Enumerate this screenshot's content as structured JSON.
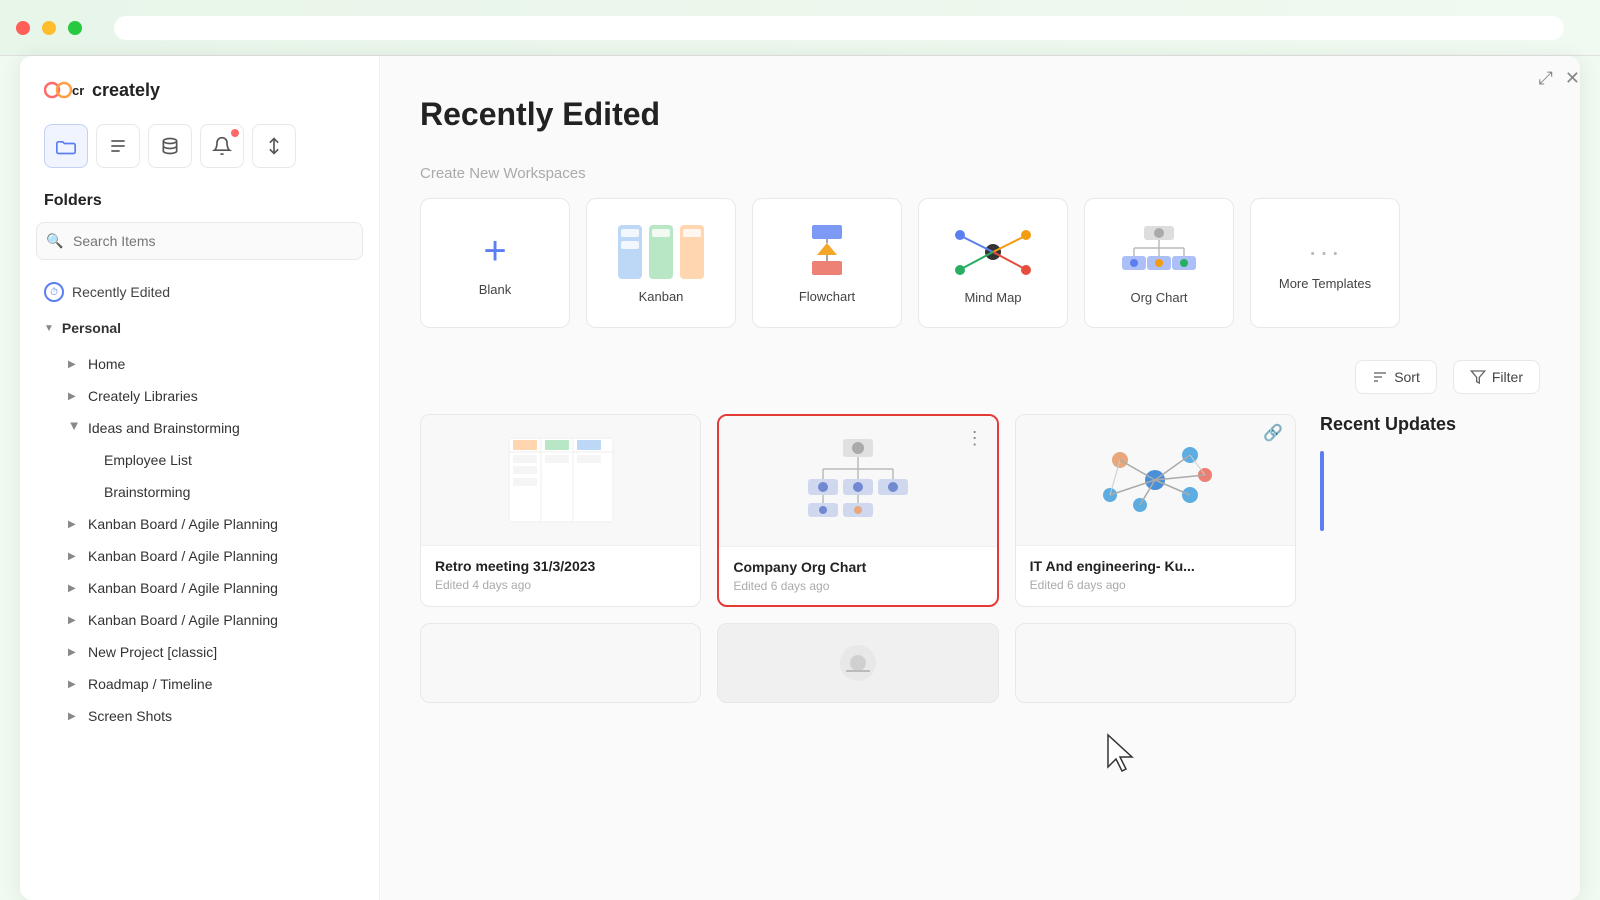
{
  "titlebar": {
    "dots": [
      "red",
      "yellow",
      "green"
    ]
  },
  "sidebar": {
    "logo_text": "creately",
    "folders_label": "Folders",
    "search_placeholder": "Search Items",
    "recently_edited_label": "Recently Edited",
    "personal_label": "Personal",
    "items": [
      {
        "label": "Home",
        "indent": 1,
        "arrow": "right"
      },
      {
        "label": "Creately Libraries",
        "indent": 1,
        "arrow": "right"
      },
      {
        "label": "Ideas and Brainstorming",
        "indent": 1,
        "arrow": "down",
        "expanded": true
      },
      {
        "label": "Employee List",
        "indent": 2,
        "arrow": ""
      },
      {
        "label": "Brainstorming",
        "indent": 2,
        "arrow": ""
      },
      {
        "label": "Kanban Board / Agile Planning",
        "indent": 1,
        "arrow": "right"
      },
      {
        "label": "Kanban Board / Agile Planning",
        "indent": 1,
        "arrow": "right"
      },
      {
        "label": "Kanban Board / Agile Planning",
        "indent": 1,
        "arrow": "right"
      },
      {
        "label": "Kanban Board / Agile Planning",
        "indent": 1,
        "arrow": "right"
      },
      {
        "label": "New Project [classic]",
        "indent": 1,
        "arrow": "right"
      },
      {
        "label": "Roadmap / Timeline",
        "indent": 1,
        "arrow": "right"
      },
      {
        "label": "Screen Shots",
        "indent": 1,
        "arrow": "right"
      }
    ]
  },
  "main": {
    "page_title": "Recently Edited",
    "create_label": "Create New Workspaces",
    "templates": [
      {
        "name": "Blank",
        "type": "blank"
      },
      {
        "name": "Kanban",
        "type": "kanban"
      },
      {
        "name": "Flowchart",
        "type": "flowchart"
      },
      {
        "name": "Mind Map",
        "type": "mindmap"
      },
      {
        "name": "Org Chart",
        "type": "orgchart"
      },
      {
        "name": "More Templates",
        "type": "more"
      }
    ],
    "sort_label": "Sort",
    "filter_label": "Filter",
    "recent_updates_title": "Recent Updates",
    "cards": [
      {
        "title": "Retro meeting 31/3/2023",
        "time": "Edited 4 days ago",
        "type": "table",
        "selected": false
      },
      {
        "title": "Company Org Chart",
        "time": "Edited 6 days ago",
        "type": "orgchart",
        "selected": true
      },
      {
        "title": "IT And engineering- Ku...",
        "time": "Edited 6 days ago",
        "type": "network",
        "selected": false
      }
    ],
    "bottom_cards": [
      {
        "type": "empty"
      },
      {
        "type": "image"
      },
      {
        "type": "empty"
      }
    ]
  }
}
